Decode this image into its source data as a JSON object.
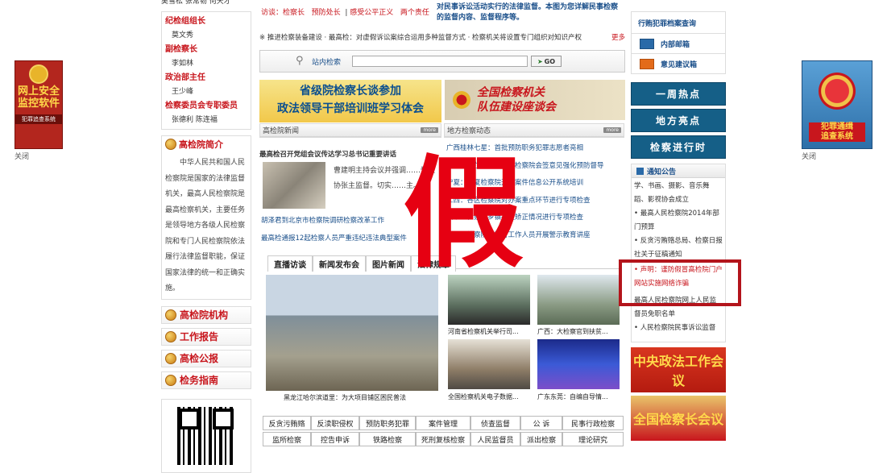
{
  "left_float_ad": {
    "line1": "网上安全",
    "line2": "监控软件",
    "footer": "犯罪追查系统",
    "close": "关闭"
  },
  "right_float_ad": {
    "line1": "犯罪通缉",
    "line2": "追查系统",
    "close": "关闭"
  },
  "leadership": {
    "top_names": "吴雪松  张常韧  何天才",
    "roles": [
      {
        "role": "纪检组组长",
        "names": "莫文秀"
      },
      {
        "role": "副检察长",
        "names": "李如林"
      },
      {
        "role": "政治部主任",
        "names": "王少峰"
      },
      {
        "role": "检察委员会专职委员",
        "names": "张德利  陈连福"
      }
    ]
  },
  "intro": {
    "title": "高检院简介",
    "text": "中华人民共和国人民检察院是国家的法律监督机关，最高人民检察院是最高检察机关，主要任务是领导地方各级人民检察院和专门人民检察院依法履行法律监督职能，保证国家法律的统一和正确实施。"
  },
  "left_nav": [
    "高检院机构",
    "工作报告",
    "高检公报",
    "检务指南"
  ],
  "top_links": {
    "items": [
      "访谈：检察长",
      "预防处长",
      "感受公平正义",
      "两个责任"
    ],
    "blurb": "对民事诉讼活动实行的法律监督。本图为您详解民事检察的监督内容、监督程序等。"
  },
  "ticker": "推进检察装备建设  · 最高检：对虚假诉讼案综合运用多种监督方式  · 检察机关将设置专门组织对知识产权",
  "ticker_more": "更多",
  "search": {
    "label": "站内检索",
    "placeholder": "",
    "button": "GO"
  },
  "banners": {
    "left": {
      "line1": "省级院检察长谈参加",
      "line2": "政法领导干部培训班学习体会"
    },
    "right": {
      "line1": "全国检察机关",
      "line2": "队伍建设座谈会"
    }
  },
  "sections": {
    "gjy": "高检院新闻",
    "local": "地方检察动态",
    "more": "more"
  },
  "gjy_headline": "最高检召开党组会议传达学习总书记重要讲话",
  "gjy_summary": "曹建明主持会议并强调……受政协张主监督。切实……主。",
  "gjy_list": [
    "胡泽君到北京市检察院调研检察改革工作",
    "最高检通报12起检察人员严重违纪违法典型案件"
  ],
  "local_list": [
    "广西桂林七星：首批预防职务犯罪志愿者亮相",
    "黑龙江哈尔滨：大庆区检察院会签意见强化预防督导",
    "宁夏：宁夏检察院开展案件信息公开系统培训",
    "江西：各区检察院对办案重点环节进行专项检查",
    "山东：检察院乡镇社区矫正情况进行专项检查",
    "浙江：检察院为银行工作人员开展警示教育讲座"
  ],
  "tabs": [
    "直播访谈",
    "新闻发布会",
    "图片新闻",
    "法律规章"
  ],
  "photos": [
    {
      "caption": "黑龙江哈尔滨道里：为大项目铺区困民普法"
    },
    {
      "caption": "河南省检察机关举行司..."
    },
    {
      "caption": "广西：大检察官到扶贫..."
    },
    {
      "caption": "全国检察机关电子数据..."
    },
    {
      "caption": "广东东莞：自编自导情..."
    }
  ],
  "fake_char": "假",
  "bottom_grid": {
    "row1": [
      "反贪污贿赂",
      "反渎职侵权",
      "预防职务犯罪",
      "案件管理",
      "侦查监督",
      "公 诉",
      "民事行政检察"
    ],
    "row2": [
      "监所检察",
      "控告申诉",
      "铁路检察",
      "死刑复核检察",
      "人民监督员",
      "派出检察",
      "理论研究"
    ]
  },
  "right_top": {
    "q1": "行贿犯罪档案查询",
    "mail": "内部邮箱",
    "suggest": "意见建议箱",
    "top_text": "行贿犯罪档案查询"
  },
  "right_buttons": [
    "一周热点",
    "地方亮点",
    "检察进行时"
  ],
  "notices": {
    "title": "通知公告",
    "items": [
      "学、书画、摄影、音乐舞蹈、影视协会成立",
      "最高人民检察院2014年部门预算",
      "反贪污贿赂总局、检察日报社关于征稿通知",
      "声明：谨防假冒高检院门户网站实施网络诈骗",
      "最高人民检察院网上人民监督员免职名单",
      "人民检察院民事诉讼监督"
    ]
  },
  "right_banners": [
    "中央政法工作会议",
    "全国检察长会议"
  ]
}
